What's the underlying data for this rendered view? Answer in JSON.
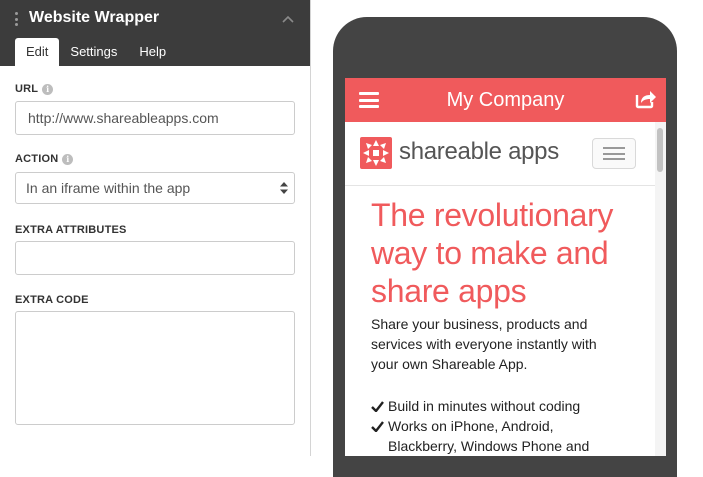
{
  "panel": {
    "title": "Website Wrapper",
    "tabs": [
      {
        "label": "Edit",
        "active": true
      },
      {
        "label": "Settings",
        "active": false
      },
      {
        "label": "Help",
        "active": false
      }
    ],
    "fields": {
      "url": {
        "label": "URL",
        "value": "http://www.shareableapps.com"
      },
      "action": {
        "label": "ACTION",
        "value": "In an iframe within the app"
      },
      "extra_attributes": {
        "label": "EXTRA ATTRIBUTES",
        "value": ""
      },
      "extra_code": {
        "label": "EXTRA CODE",
        "value": ""
      }
    },
    "icons": {
      "drag": "drag-handle-icon",
      "collapse": "chevron-up-icon",
      "info": "info-icon",
      "select": "select-arrows-icon",
      "resize": "resize-grip-icon"
    },
    "colors": {
      "header_bg": "#3c3c3c"
    }
  },
  "preview": {
    "app_bar": {
      "title": "My Company",
      "menu_icon": "hamburger-menu-icon",
      "share_icon": "share-icon",
      "color": "#f05a5c"
    },
    "site": {
      "logo_text": "shareable apps",
      "logo_icon": "shareable-apps-logo-icon",
      "nav_toggle_icon": "hamburger-menu-icon",
      "hero_title_lines": [
        "The revolutionary",
        "way to make and",
        "share apps"
      ],
      "hero_text_lines": [
        "Share your business, products and",
        "services with everyone instantly with",
        "your own Shareable App."
      ],
      "features": [
        {
          "lines": [
            "Build in minutes without coding"
          ]
        },
        {
          "lines": [
            "Works on iPhone, Android,",
            "Blackberry, Windows Phone and"
          ]
        }
      ],
      "feature_icon": "checkmark-icon",
      "accent_color": "#f05a5c"
    }
  }
}
